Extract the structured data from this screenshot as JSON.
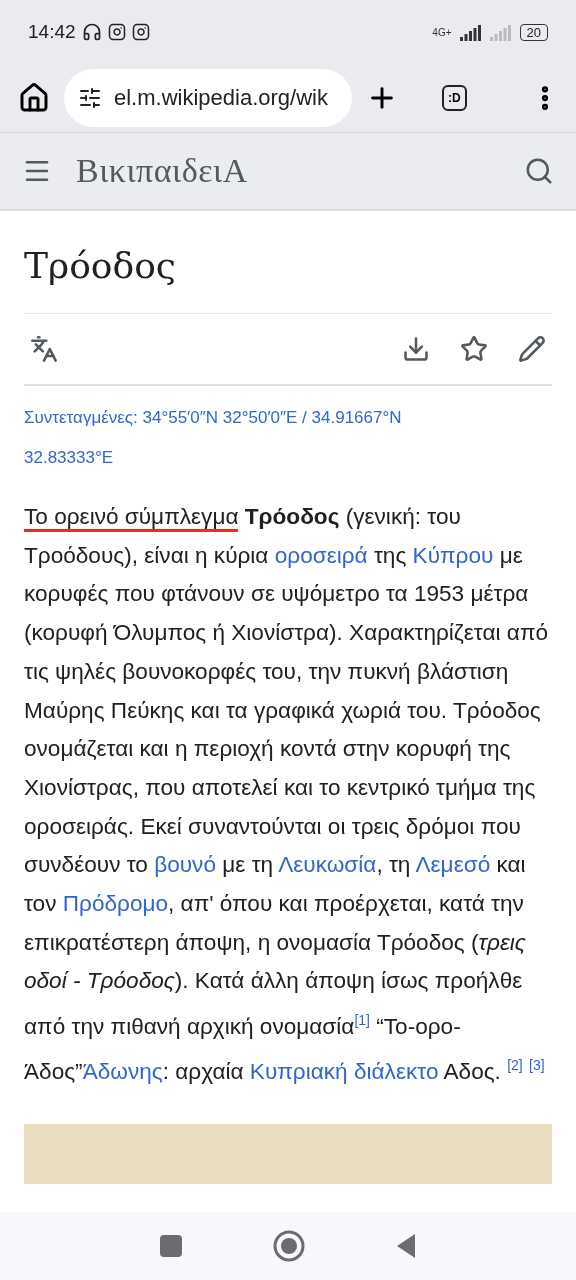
{
  "status_bar": {
    "time": "14:42",
    "network": "4G+",
    "battery": "20",
    "notifications": [
      {
        "kind": "headphones"
      },
      {
        "kind": "instagram"
      },
      {
        "kind": "instagram"
      }
    ]
  },
  "browser": {
    "url": "el.m.wikipedia.org/wik",
    "tab_count": ":D"
  },
  "site_header": {
    "logo": "ΒικιπαιδειΑ"
  },
  "article": {
    "title": "Τρόοδος",
    "actions": [
      {
        "kind": "language"
      },
      {
        "kind": "spacer"
      },
      {
        "kind": "download"
      },
      {
        "kind": "star"
      },
      {
        "kind": "edit"
      }
    ],
    "coordinates": "Συντεταγμένες: 34°55′0″N 32°50′0″E / 34.91667°N 32.83333°E",
    "paragraph": [
      {
        "kind": "marked",
        "text": "Το ορεινό σύμπλεγμα"
      },
      {
        "kind": "space"
      },
      {
        "kind": "bold",
        "text": "Τρόοδος"
      },
      {
        "kind": "text",
        "text": " (γενική: του Τροόδους), είναι η κύρια "
      },
      {
        "kind": "link",
        "text": "οροσειρά"
      },
      {
        "kind": "text",
        "text": " της "
      },
      {
        "kind": "link",
        "text": "Κύπρου"
      },
      {
        "kind": "text",
        "text": " με κορυφές που φτάνουν σε υψόμετρο τα 1953 μέτρα (κορυφή Όλυμπος ή Χιονίστρα). Χαρακτηρίζεται από τις ψηλές βουνοκορφές του, την πυκνή βλάστιση Μαύρης Πεύκης και τα γραφικά χωριά του. Τρόοδος ονομάζεται και η περιοχή κοντά στην κορυφή της Χιονίστρας, που αποτελεί και το κεντρικό τμήμα της οροσειράς. Εκεί συναντούνται οι τρεις δρόμοι που συνδέουν το "
      },
      {
        "kind": "link",
        "text": "βουνό"
      },
      {
        "kind": "text",
        "text": " με τη "
      },
      {
        "kind": "link",
        "text": "Λευκωσία"
      },
      {
        "kind": "text",
        "text": ", τη "
      },
      {
        "kind": "link",
        "text": "Λεμεσό"
      },
      {
        "kind": "text",
        "text": " και τον "
      },
      {
        "kind": "link",
        "text": "Πρόδρομο"
      },
      {
        "kind": "text",
        "text": ", απ' όπου και προέρχεται, κατά την επικρατέστερη άποψη, η ονομασία Τρόοδος ("
      },
      {
        "kind": "italic",
        "text": "τρεις οδοί - Τρόοδος"
      },
      {
        "kind": "text",
        "text": "). Κατά άλλη άποψη ίσως προήλθε από την πιθανή αρχική ονομασία"
      },
      {
        "kind": "ref",
        "text": "[1]"
      },
      {
        "kind": "text",
        "text": " “Το-ορο-Άδος”"
      },
      {
        "kind": "link",
        "text": "Άδωνης"
      },
      {
        "kind": "text",
        "text": ": αρχαία "
      },
      {
        "kind": "link",
        "text": "Κυπριακή διάλεκτο"
      },
      {
        "kind": "text",
        "text": " Αδος. "
      },
      {
        "kind": "ref",
        "text": "[2]"
      },
      {
        "kind": "space"
      },
      {
        "kind": "ref",
        "text": "[3]"
      }
    ]
  }
}
